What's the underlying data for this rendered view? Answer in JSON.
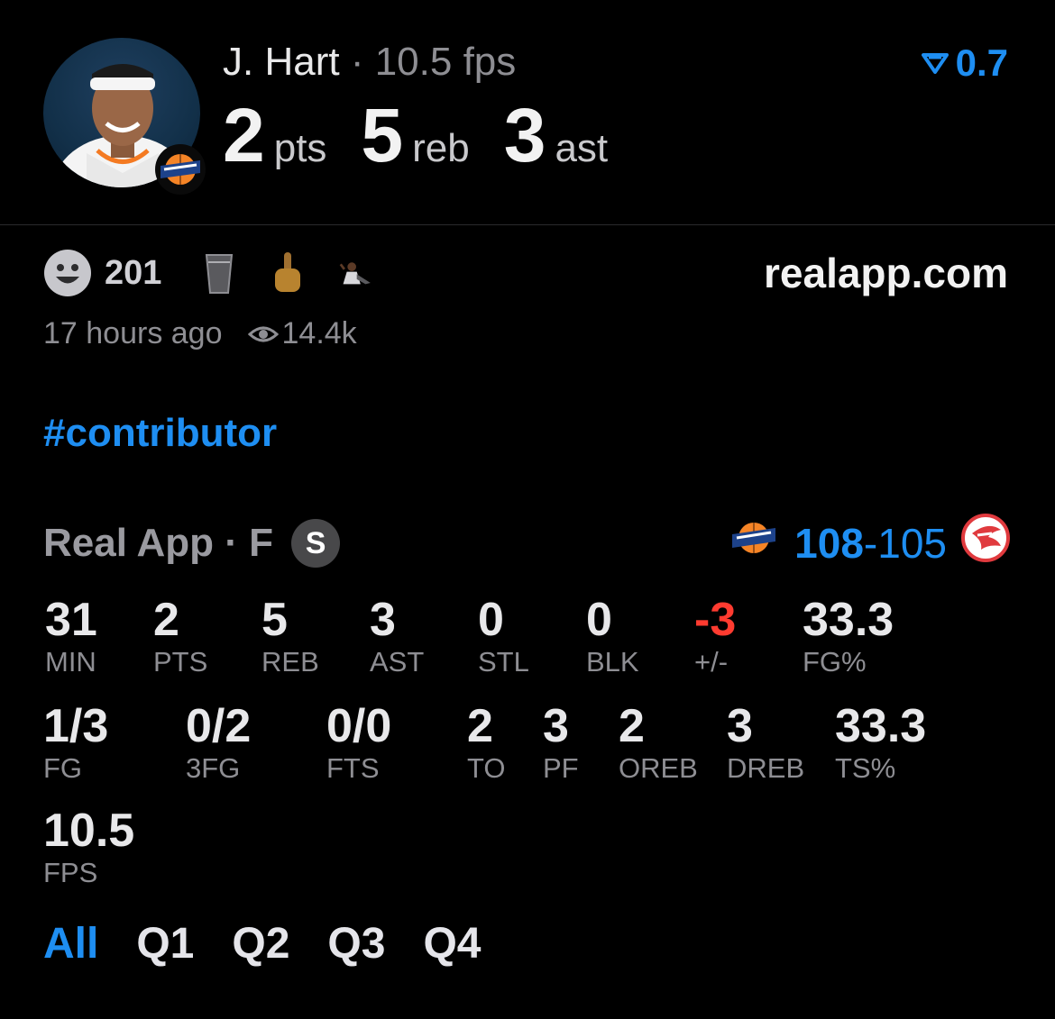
{
  "header": {
    "player_name": "J. Hart",
    "separator": "·",
    "fps_text": "10.5 fps",
    "pts_value": "2",
    "pts_unit": "pts",
    "reb_value": "5",
    "reb_unit": "reb",
    "ast_value": "3",
    "ast_unit": "ast",
    "trend_value": "0.7"
  },
  "reactions": {
    "count": "201",
    "site": "realapp.com"
  },
  "meta": {
    "time_ago": "17 hours ago",
    "views": "14.4k"
  },
  "tag": "#contributor",
  "game": {
    "source": "Real App · F",
    "badge": "S",
    "home_score": "108",
    "dash": "-",
    "away_score": "105"
  },
  "stats_row1": [
    {
      "value": "31",
      "label": "MIN"
    },
    {
      "value": "2",
      "label": "PTS"
    },
    {
      "value": "5",
      "label": "REB"
    },
    {
      "value": "3",
      "label": "AST"
    },
    {
      "value": "0",
      "label": "STL"
    },
    {
      "value": "0",
      "label": "BLK"
    },
    {
      "value": "-3",
      "label": "+/-"
    },
    {
      "value": "33.3",
      "label": "FG%"
    }
  ],
  "stats_row2": [
    {
      "value": "1/3",
      "label": "FG"
    },
    {
      "value": "0/2",
      "label": "3FG"
    },
    {
      "value": "0/0",
      "label": "FTS"
    },
    {
      "value": "2",
      "label": "TO"
    },
    {
      "value": "3",
      "label": "PF"
    },
    {
      "value": "2",
      "label": "OREB"
    },
    {
      "value": "3",
      "label": "DREB"
    },
    {
      "value": "33.3",
      "label": "TS%"
    }
  ],
  "stats_row3": [
    {
      "value": "10.5",
      "label": "FPS"
    }
  ],
  "tabs": [
    "All",
    "Q1",
    "Q2",
    "Q3",
    "Q4"
  ],
  "colors": {
    "accent": "#1e8ef2",
    "negative": "#ff3b30",
    "muted": "#8e8e93",
    "background": "#000000"
  }
}
